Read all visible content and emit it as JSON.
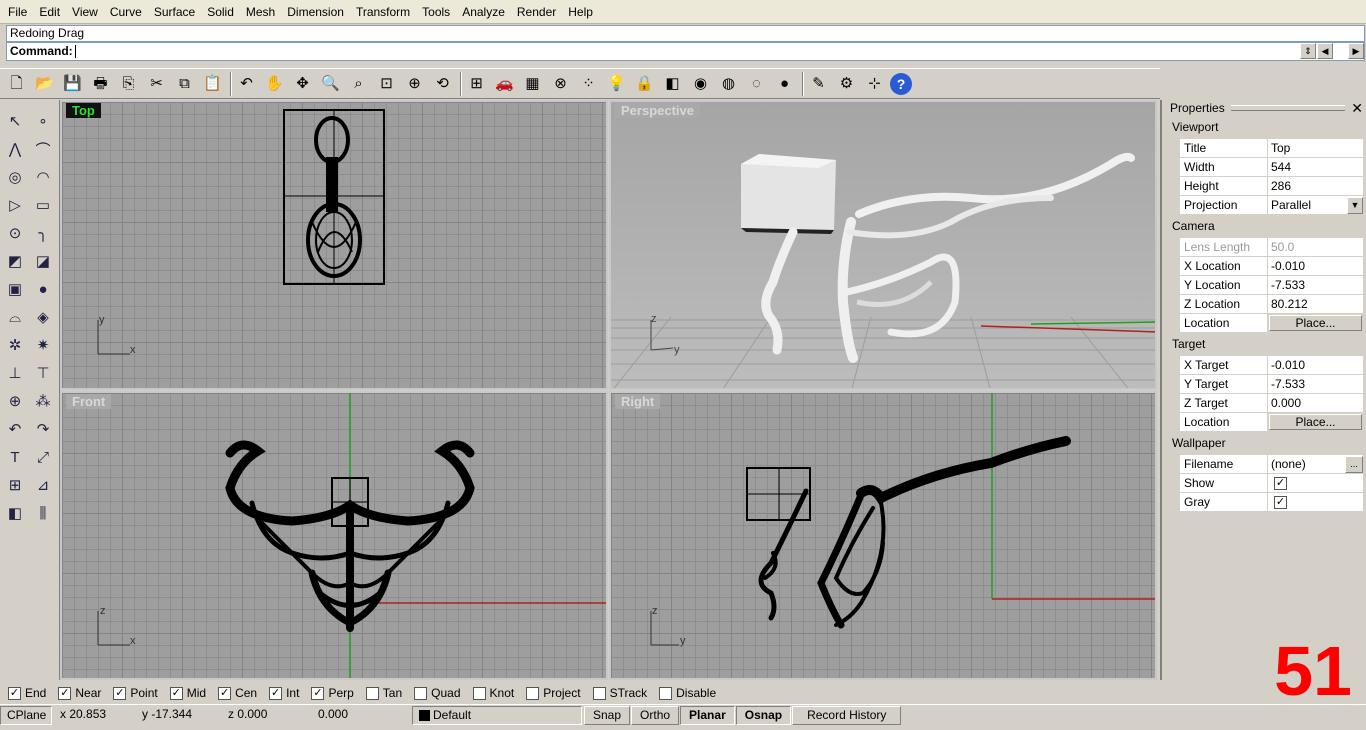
{
  "menu": [
    "File",
    "Edit",
    "View",
    "Curve",
    "Surface",
    "Solid",
    "Mesh",
    "Dimension",
    "Transform",
    "Tools",
    "Analyze",
    "Render",
    "Help"
  ],
  "command": {
    "history": "Redoing Drag",
    "prompt": "Command:"
  },
  "toolbar_icons": [
    "new-file-icon",
    "open-icon",
    "save-icon",
    "print-icon",
    "import-icon",
    "cut-icon",
    "copy-icon",
    "paste-icon",
    "undo-icon",
    "pan-icon",
    "rotate-view-icon",
    "zoom-icon",
    "zoom-window-icon",
    "zoom-extents-icon",
    "zoom-selected-icon",
    "undo-view-icon",
    "four-viewports-icon",
    "car-icon",
    "grid-plane-icon",
    "cplane-icon",
    "points-icon",
    "light-icon",
    "lock-icon",
    "layer-icon",
    "color-wheel-icon",
    "wireframe-sphere-icon",
    "shaded-sphere-icon",
    "rendered-sphere-icon",
    "highlighter-icon",
    "options-gear-icon",
    "dimension-icon",
    "help-icon"
  ],
  "viewports": {
    "top": {
      "title": "Top",
      "axis_a": "y",
      "axis_b": "x"
    },
    "perspective": {
      "title": "Perspective",
      "axis_a": "z",
      "axis_b": "y"
    },
    "front": {
      "title": "Front",
      "axis_a": "z",
      "axis_b": "x"
    },
    "right": {
      "title": "Right",
      "axis_a": "z",
      "axis_b": "y"
    }
  },
  "properties": {
    "header": "Properties",
    "viewport_section": "Viewport",
    "title_label": "Title",
    "title_value": "Top",
    "width_label": "Width",
    "width_value": "544",
    "height_label": "Height",
    "height_value": "286",
    "projection_label": "Projection",
    "projection_value": "Parallel",
    "camera_section": "Camera",
    "lens_label": "Lens Length",
    "lens_value": "50.0",
    "xloc_label": "X Location",
    "xloc_value": "-0.010",
    "yloc_label": "Y Location",
    "yloc_value": "-7.533",
    "zloc_label": "Z Location",
    "zloc_value": "80.212",
    "location_label": "Location",
    "place_label": "Place...",
    "target_section": "Target",
    "xtgt_label": "X Target",
    "xtgt_value": "-0.010",
    "ytgt_label": "Y Target",
    "ytgt_value": "-7.533",
    "ztgt_label": "Z Target",
    "ztgt_value": "0.000",
    "tloc_label": "Location",
    "tplace_label": "Place...",
    "wallpaper_section": "Wallpaper",
    "filename_label": "Filename",
    "filename_value": "(none)",
    "browse_label": "...",
    "show_label": "Show",
    "gray_label": "Gray"
  },
  "osnaps": [
    {
      "label": "End",
      "checked": true
    },
    {
      "label": "Near",
      "checked": true
    },
    {
      "label": "Point",
      "checked": true
    },
    {
      "label": "Mid",
      "checked": true
    },
    {
      "label": "Cen",
      "checked": true
    },
    {
      "label": "Int",
      "checked": true
    },
    {
      "label": "Perp",
      "checked": true
    },
    {
      "label": "Tan",
      "checked": false
    },
    {
      "label": "Quad",
      "checked": false
    },
    {
      "label": "Knot",
      "checked": false
    },
    {
      "label": "Project",
      "checked": false
    },
    {
      "label": "STrack",
      "checked": false
    },
    {
      "label": "Disable",
      "checked": false
    }
  ],
  "status": {
    "cplane": "CPlane",
    "x": "x 20.853",
    "y": "y -17.344",
    "z": "z 0.000",
    "dist": "0.000",
    "layer": "Default",
    "snap": "Snap",
    "ortho": "Ortho",
    "planar": "Planar",
    "osnap": "Osnap",
    "record": "Record History"
  },
  "overlay_number": "51",
  "colors": {
    "active_title_bg": "#111111",
    "active_title_fg": "#2fe02f",
    "overlay": "#ff0000",
    "x_axis": "#b02020",
    "y_axis": "#20a020"
  }
}
